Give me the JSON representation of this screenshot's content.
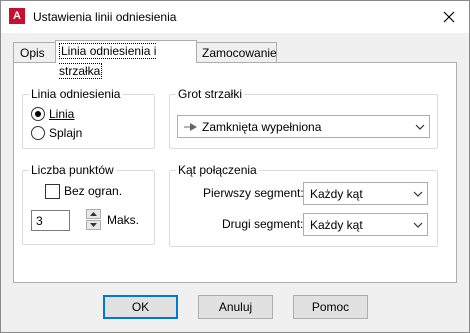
{
  "window": {
    "title": "Ustawienia linii odniesienia",
    "app_icon_letter": "A"
  },
  "tabs": [
    {
      "label": "Opis",
      "active": false
    },
    {
      "label": "Linia odniesienia i strzałka",
      "active": true
    },
    {
      "label": "Zamocowanie",
      "active": false
    }
  ],
  "leader_group": {
    "title": "Linia odniesienia",
    "options": [
      {
        "label": "Linia",
        "selected": true
      },
      {
        "label": "Splajn",
        "selected": false
      }
    ]
  },
  "arrow_group": {
    "title": "Grot strzałki",
    "value": "Zamknięta wypełniona"
  },
  "points_group": {
    "title": "Liczba punktów",
    "no_limit_label": "Bez ogran.",
    "no_limit_checked": false,
    "max_value": "3",
    "max_label": "Maks."
  },
  "angle_group": {
    "title": "Kąt połączenia",
    "first_label": "Pierwszy segment:",
    "first_value": "Każdy kąt",
    "second_label": "Drugi segment:",
    "second_value": "Każdy kąt"
  },
  "buttons": {
    "ok": "OK",
    "cancel": "Anuluj",
    "help": "Pomoc"
  }
}
